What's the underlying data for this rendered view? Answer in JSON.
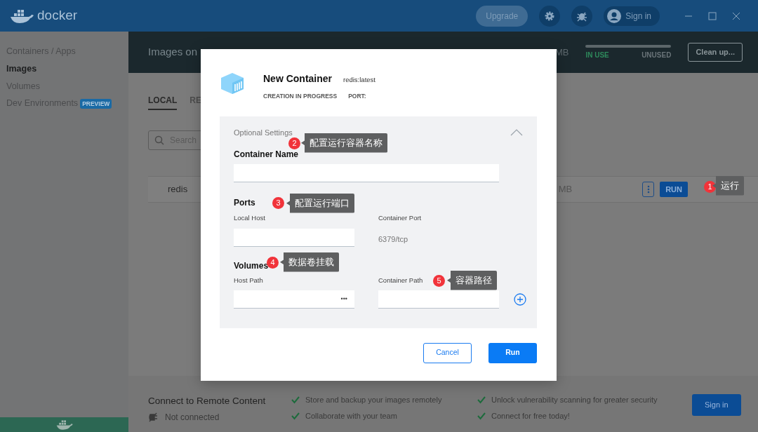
{
  "window": {
    "app_name": "docker",
    "upgrade": "Upgrade",
    "sign_in": "Sign in"
  },
  "sidebar": {
    "items": [
      {
        "label": "Containers / Apps",
        "selected": false
      },
      {
        "label": "Images",
        "selected": true
      },
      {
        "label": "Volumes",
        "selected": false
      },
      {
        "label": "Dev Environments",
        "badge": "PREVIEW",
        "selected": false
      }
    ]
  },
  "header": {
    "title": "Images on",
    "size": "MB",
    "in_use": "IN USE",
    "unused": "UNUSED",
    "clean_up": "Clean up..."
  },
  "tabs": [
    {
      "label": "LOCAL",
      "selected": true
    },
    {
      "label": "RE",
      "selected": false
    }
  ],
  "search": {
    "placeholder": "Search"
  },
  "images": [
    {
      "name": "redis",
      "size": "MB",
      "run": "RUN"
    }
  ],
  "remote": {
    "title": "Connect to Remote Content",
    "status": "Not connected",
    "features": [
      "Store and backup your images remotely",
      "Unlock vulnerability scanning for greater security",
      "Collaborate with your team",
      "Connect for free today!"
    ],
    "sign_in": "Sign in"
  },
  "dialog": {
    "title": "New Container",
    "image": "redis:latest",
    "status": "CREATION IN PROGRESS",
    "port": "PORT:",
    "optional": {
      "label": "Optional Settings",
      "expanded": true
    },
    "container_name": {
      "label": "Container Name"
    },
    "ports": {
      "label": "Ports",
      "local_host": "Local Host",
      "container_port": "Container Port",
      "port_value": "6379/tcp"
    },
    "volumes": {
      "label": "Volumes",
      "host_path": "Host Path",
      "browse": "•••",
      "container_path": "Container Path"
    },
    "cancel": "Cancel",
    "run": "Run"
  },
  "annotations": [
    {
      "number": "1",
      "text": "运行"
    },
    {
      "number": "2",
      "text": "配置运行容器名称"
    },
    {
      "number": "3",
      "text": "配置运行端口"
    },
    {
      "number": "4",
      "text": "数据卷挂载"
    },
    {
      "number": "5",
      "text": "容器路径"
    }
  ]
}
